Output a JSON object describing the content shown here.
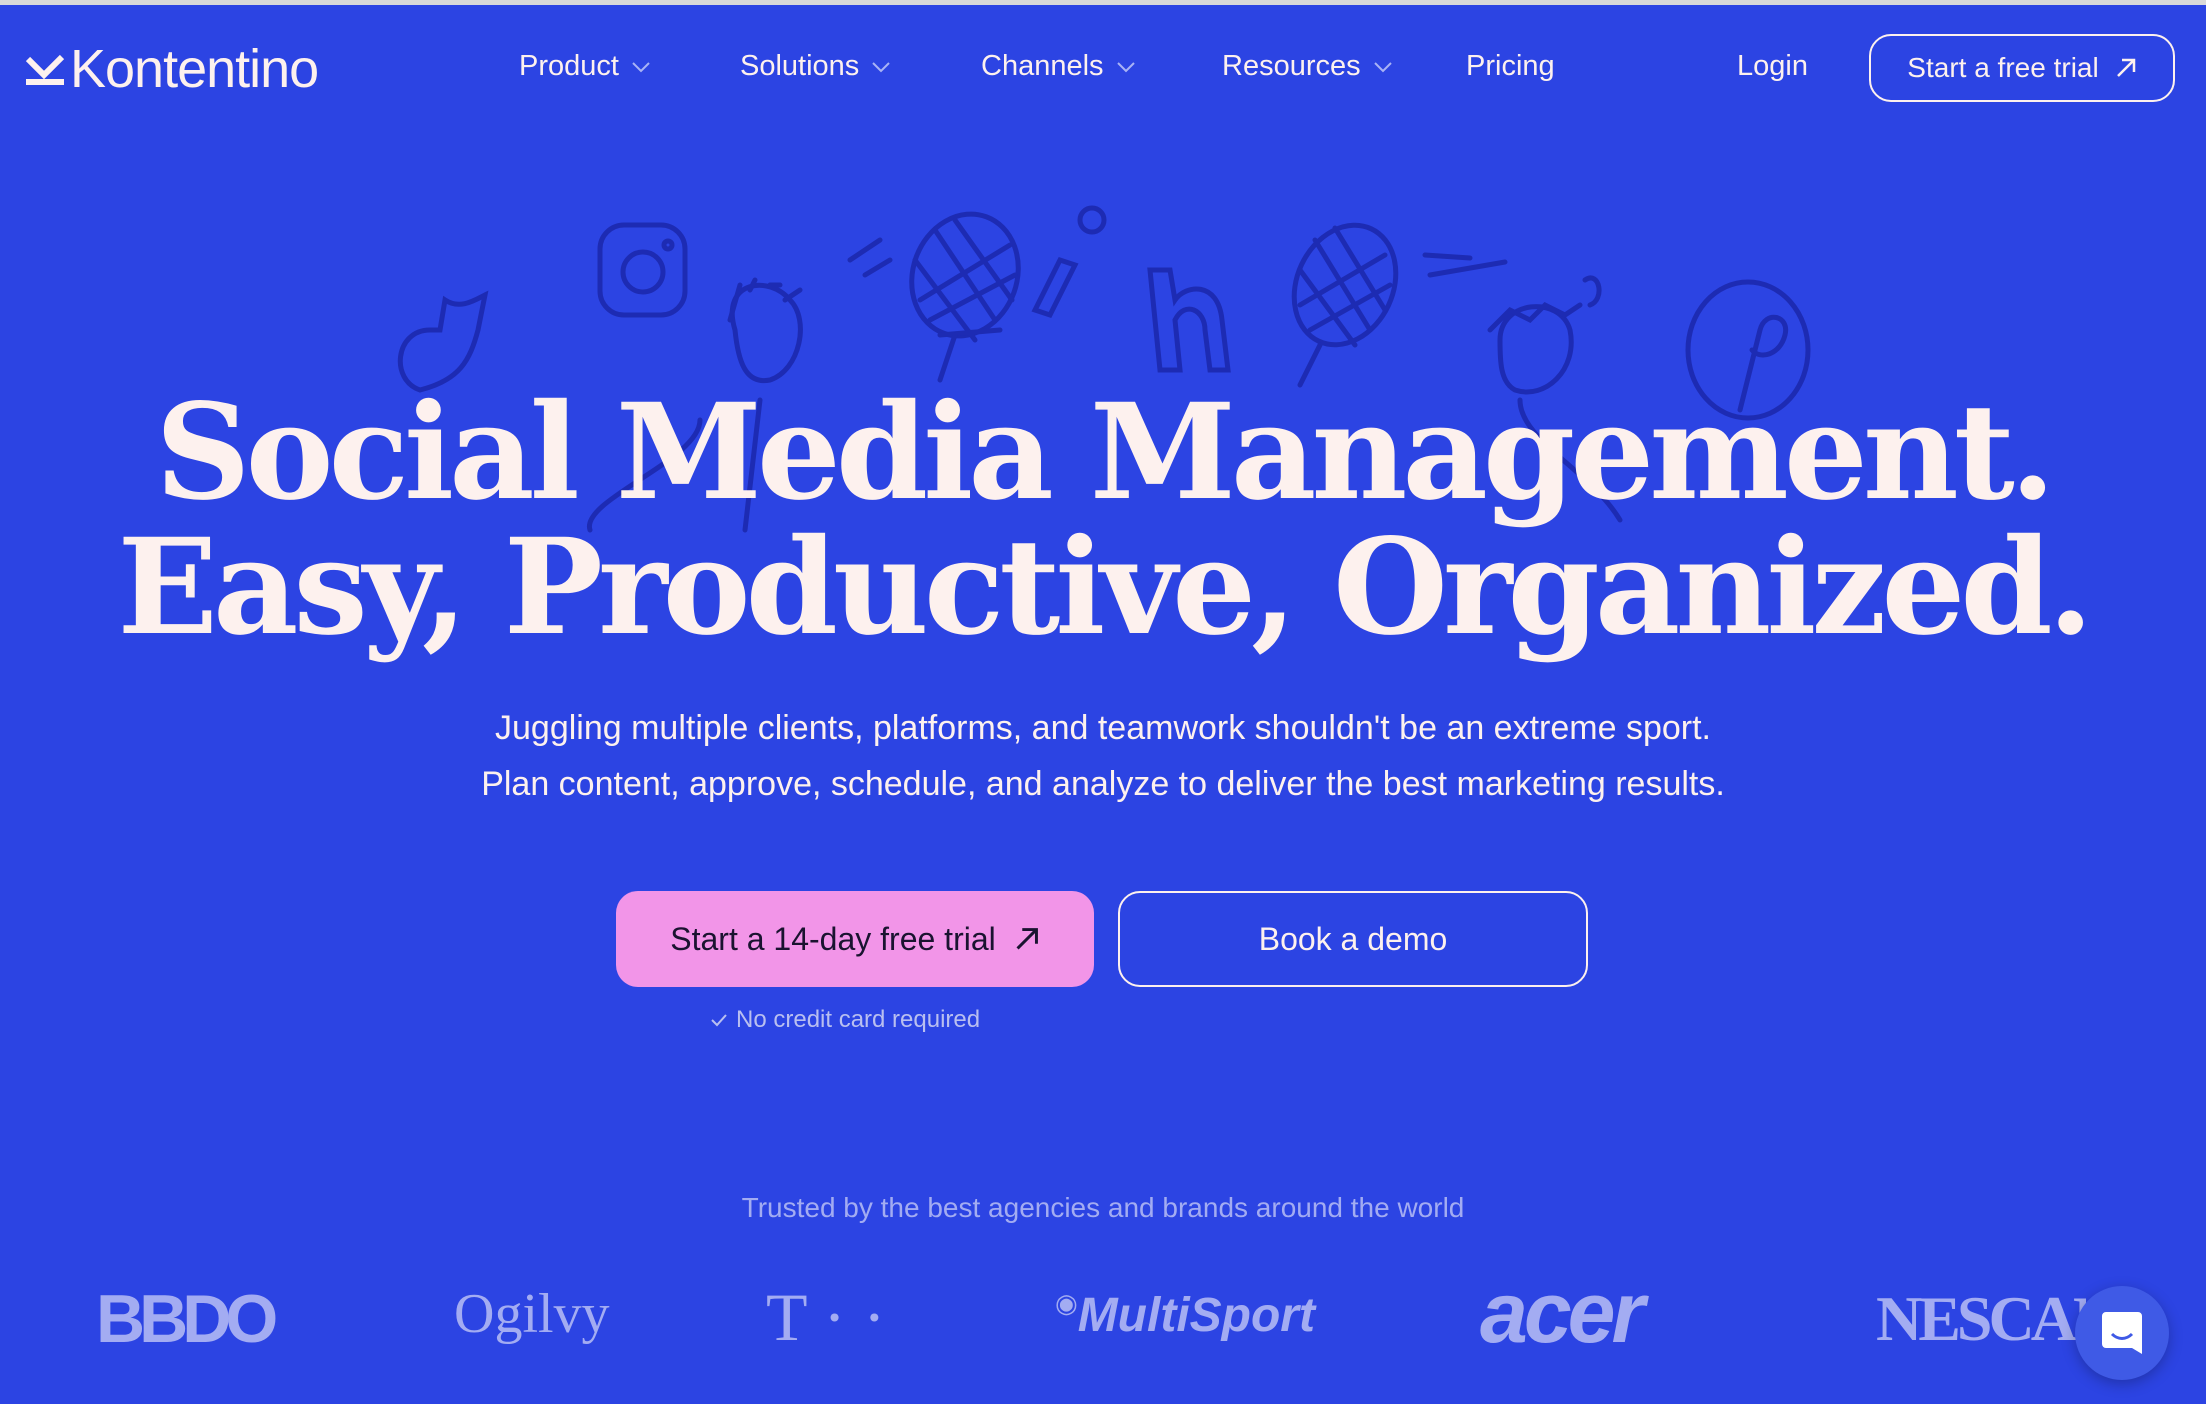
{
  "colors": {
    "background": "#2c44e3",
    "text": "#fdf1ee",
    "primary_button": "#f295e8",
    "muted": "#a3acf2",
    "illustration": "#1d2bb3"
  },
  "header": {
    "logo": "Kontentino",
    "nav": [
      {
        "label": "Product",
        "has_dropdown": true
      },
      {
        "label": "Solutions",
        "has_dropdown": true
      },
      {
        "label": "Channels",
        "has_dropdown": true
      },
      {
        "label": "Resources",
        "has_dropdown": true
      },
      {
        "label": "Pricing",
        "has_dropdown": false
      }
    ],
    "login": "Login",
    "trial_button": "Start a free trial",
    "trial_icon": "arrow-up-right-icon"
  },
  "hero": {
    "headline_line1": "Social Media Management.",
    "headline_line2": "Easy, Productive, Organized.",
    "subtitle_line1": "Juggling multiple clients, platforms, and teamwork shouldn't be an extreme sport.",
    "subtitle_line2": "Plan content, approve, schedule, and analyze to deliver the best marketing results.",
    "primary_cta": "Start a 14-day free trial",
    "secondary_cta": "Book a demo",
    "note": "No credit card required",
    "note_icon": "check-icon"
  },
  "trusted": {
    "title": "Trusted by the best agencies and brands around the world",
    "brands": [
      "BBDO",
      "Ogilvy",
      "T · ·",
      "MultiSport",
      "acer",
      "NESCAFÉ"
    ]
  },
  "chat": {
    "icon": "chat-bubble-icon"
  }
}
